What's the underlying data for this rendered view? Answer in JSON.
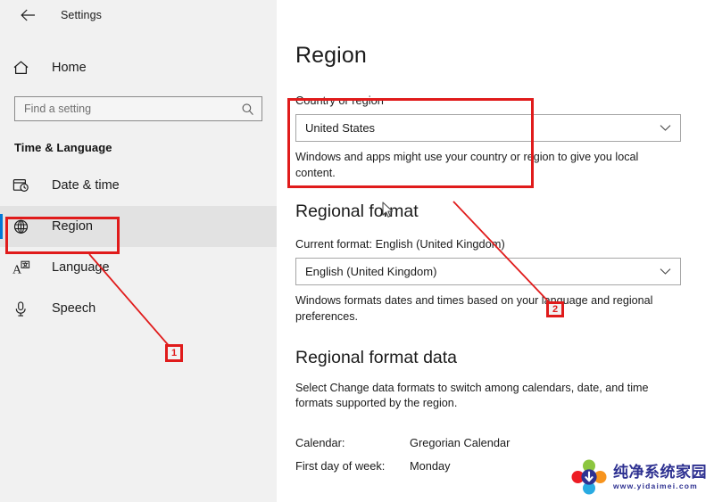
{
  "window": {
    "app_title": "Settings",
    "back_icon": "back-arrow-icon"
  },
  "sidebar": {
    "home": {
      "label": "Home",
      "icon": "home-icon"
    },
    "search": {
      "placeholder": "Find a setting",
      "value": "",
      "icon": "search-icon"
    },
    "group_title": "Time & Language",
    "items": [
      {
        "label": "Date & time",
        "icon": "calendar-clock-icon",
        "selected": false
      },
      {
        "label": "Region",
        "icon": "globe-icon",
        "selected": true
      },
      {
        "label": "Language",
        "icon": "language-icon",
        "selected": false
      },
      {
        "label": "Speech",
        "icon": "microphone-icon",
        "selected": false
      }
    ]
  },
  "main": {
    "page_title": "Region",
    "country": {
      "label": "Country or region",
      "value": "United States",
      "chevron_icon": "chevron-down-icon",
      "help": "Windows and apps might use your country or region to give you local content."
    },
    "regional_format": {
      "heading": "Regional format",
      "current_format_label": "Current format: English (United Kingdom)",
      "value": "English (United Kingdom)",
      "chevron_icon": "chevron-down-icon",
      "help": "Windows formats dates and times based on your language and regional preferences."
    },
    "regional_format_data": {
      "heading": "Regional format data",
      "help": "Select Change data formats to switch among calendars, date, and time formats supported by the region.",
      "rows": [
        {
          "key": "Calendar:",
          "value": "Gregorian Calendar"
        },
        {
          "key": "First day of week:",
          "value": "Monday"
        }
      ]
    }
  },
  "annotations": {
    "badges": [
      {
        "text": "1"
      },
      {
        "text": "2"
      }
    ],
    "accent_color": "#e01b1b"
  },
  "watermark": {
    "name_cn": "纯净系统家园",
    "url": "www.yidaimei.com"
  },
  "colors": {
    "selection_blue": "#0078d7",
    "sidebar_bg": "#f1f1f1",
    "annotation_red": "#e01b1b"
  }
}
